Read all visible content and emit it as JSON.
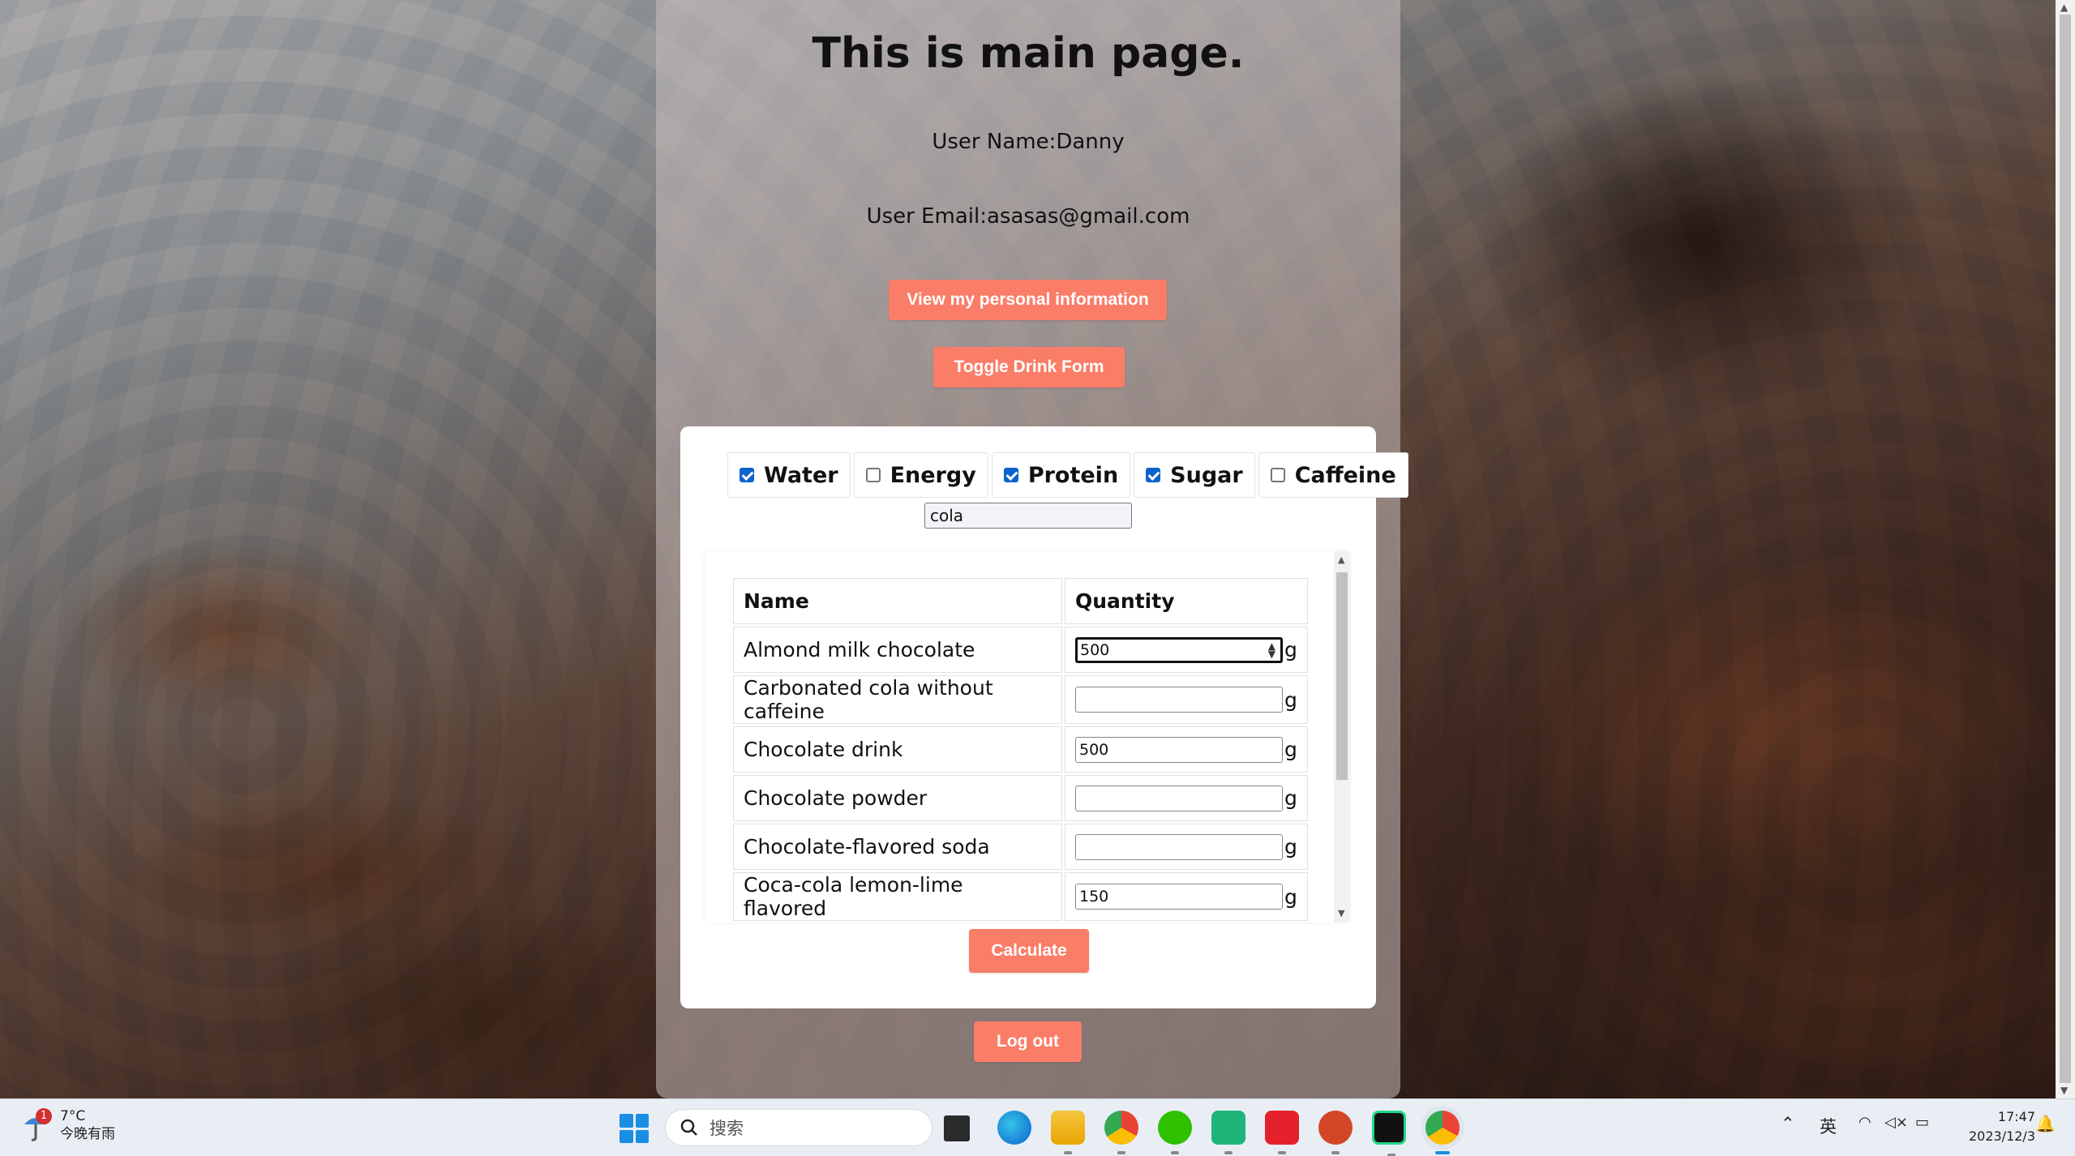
{
  "page": {
    "title": "This is main page.",
    "user_name": "User Name:Danny",
    "user_email": "User Email:asasas@gmail.com",
    "view_info_button": "View my personal information",
    "toggle_button": "Toggle Drink Form",
    "calculate_button": "Calculate",
    "logout_button": "Log out"
  },
  "filters": [
    {
      "label": "Water",
      "checked": true
    },
    {
      "label": "Energy",
      "checked": false
    },
    {
      "label": "Protein",
      "checked": true
    },
    {
      "label": "Sugar",
      "checked": true
    },
    {
      "label": "Caffeine",
      "checked": false
    }
  ],
  "search": {
    "value": "cola"
  },
  "table": {
    "headers": [
      "Name",
      "Quantity"
    ],
    "unit": "g",
    "rows": [
      {
        "name": "Almond milk chocolate",
        "qty": "500"
      },
      {
        "name": "Carbonated cola without caffeine",
        "qty": ""
      },
      {
        "name": "Chocolate drink",
        "qty": "500"
      },
      {
        "name": "Chocolate powder",
        "qty": ""
      },
      {
        "name": "Chocolate-flavored soda",
        "qty": ""
      },
      {
        "name": "Coca-cola lemon-lime flavored",
        "qty": "150"
      }
    ]
  },
  "taskbar": {
    "weather_temp": "7°C",
    "weather_desc": "今晚有雨",
    "weather_badge": "1",
    "search_placeholder": "搜索",
    "ime": "英",
    "time": "17:47",
    "date": "2023/12/3"
  },
  "colors": {
    "accent": "#fa7d68",
    "checkbox": "#0b63ce"
  }
}
